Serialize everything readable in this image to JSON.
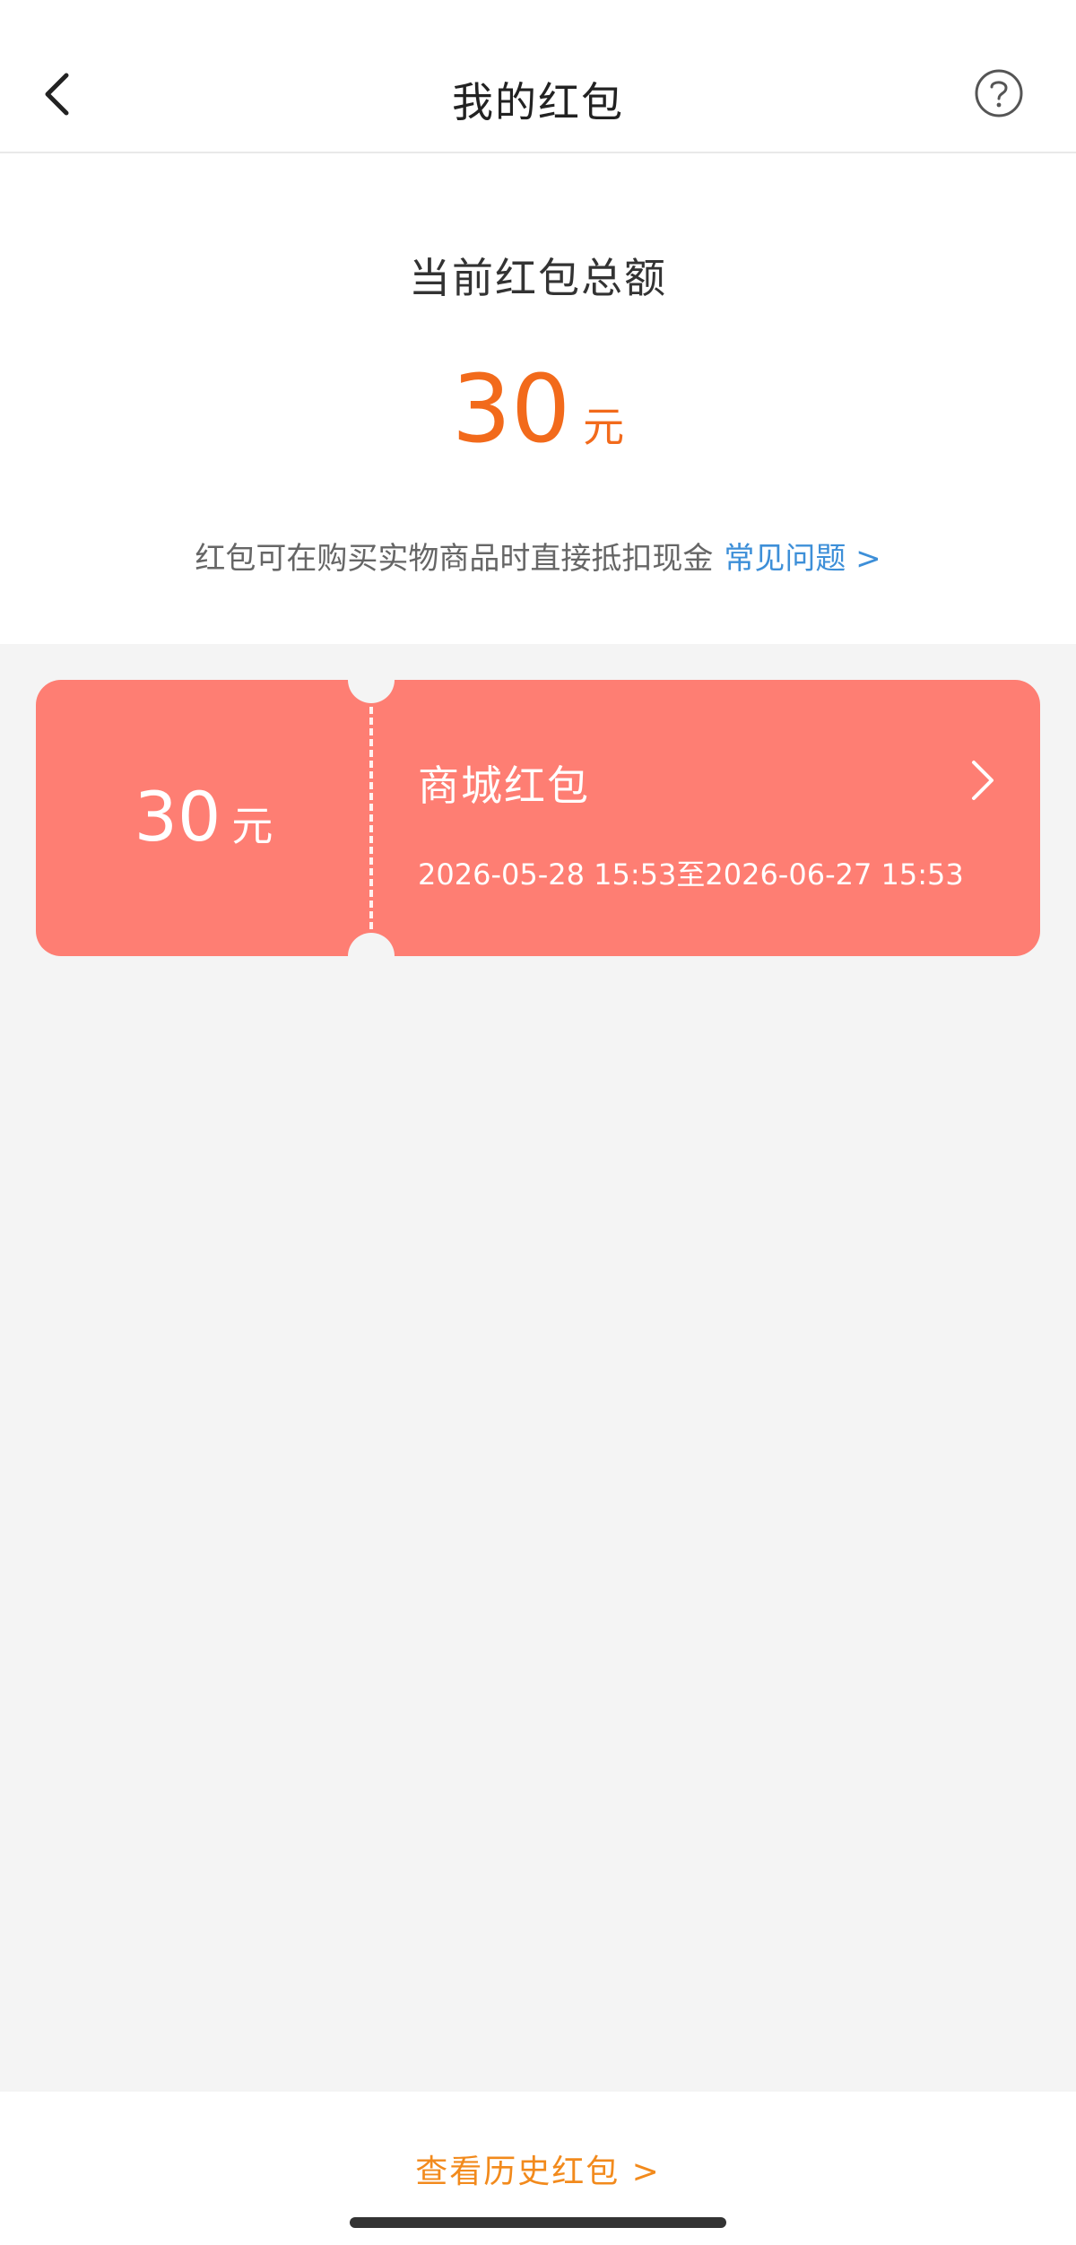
{
  "nav": {
    "title": "我的红包",
    "back_icon": "chevron-left-icon",
    "help_icon": "question-circle-icon"
  },
  "summary": {
    "title": "当前红包总额",
    "amount": "30",
    "unit": "元",
    "note": "红包可在购买实物商品时直接抵扣现金",
    "faq_link": "常见问题 >",
    "amount_color": "#f26a1b",
    "link_color": "#3d8fd8"
  },
  "coupons": [
    {
      "value": "30",
      "unit": "元",
      "name": "商城红包",
      "period": "2026-05-28 15:53至2026-06-27 15:53",
      "color": "#fe7e73",
      "chevron_icon": "chevron-right-icon"
    }
  ],
  "footer": {
    "history_link": "查看历史红包 >",
    "link_color": "#f28a1c"
  }
}
